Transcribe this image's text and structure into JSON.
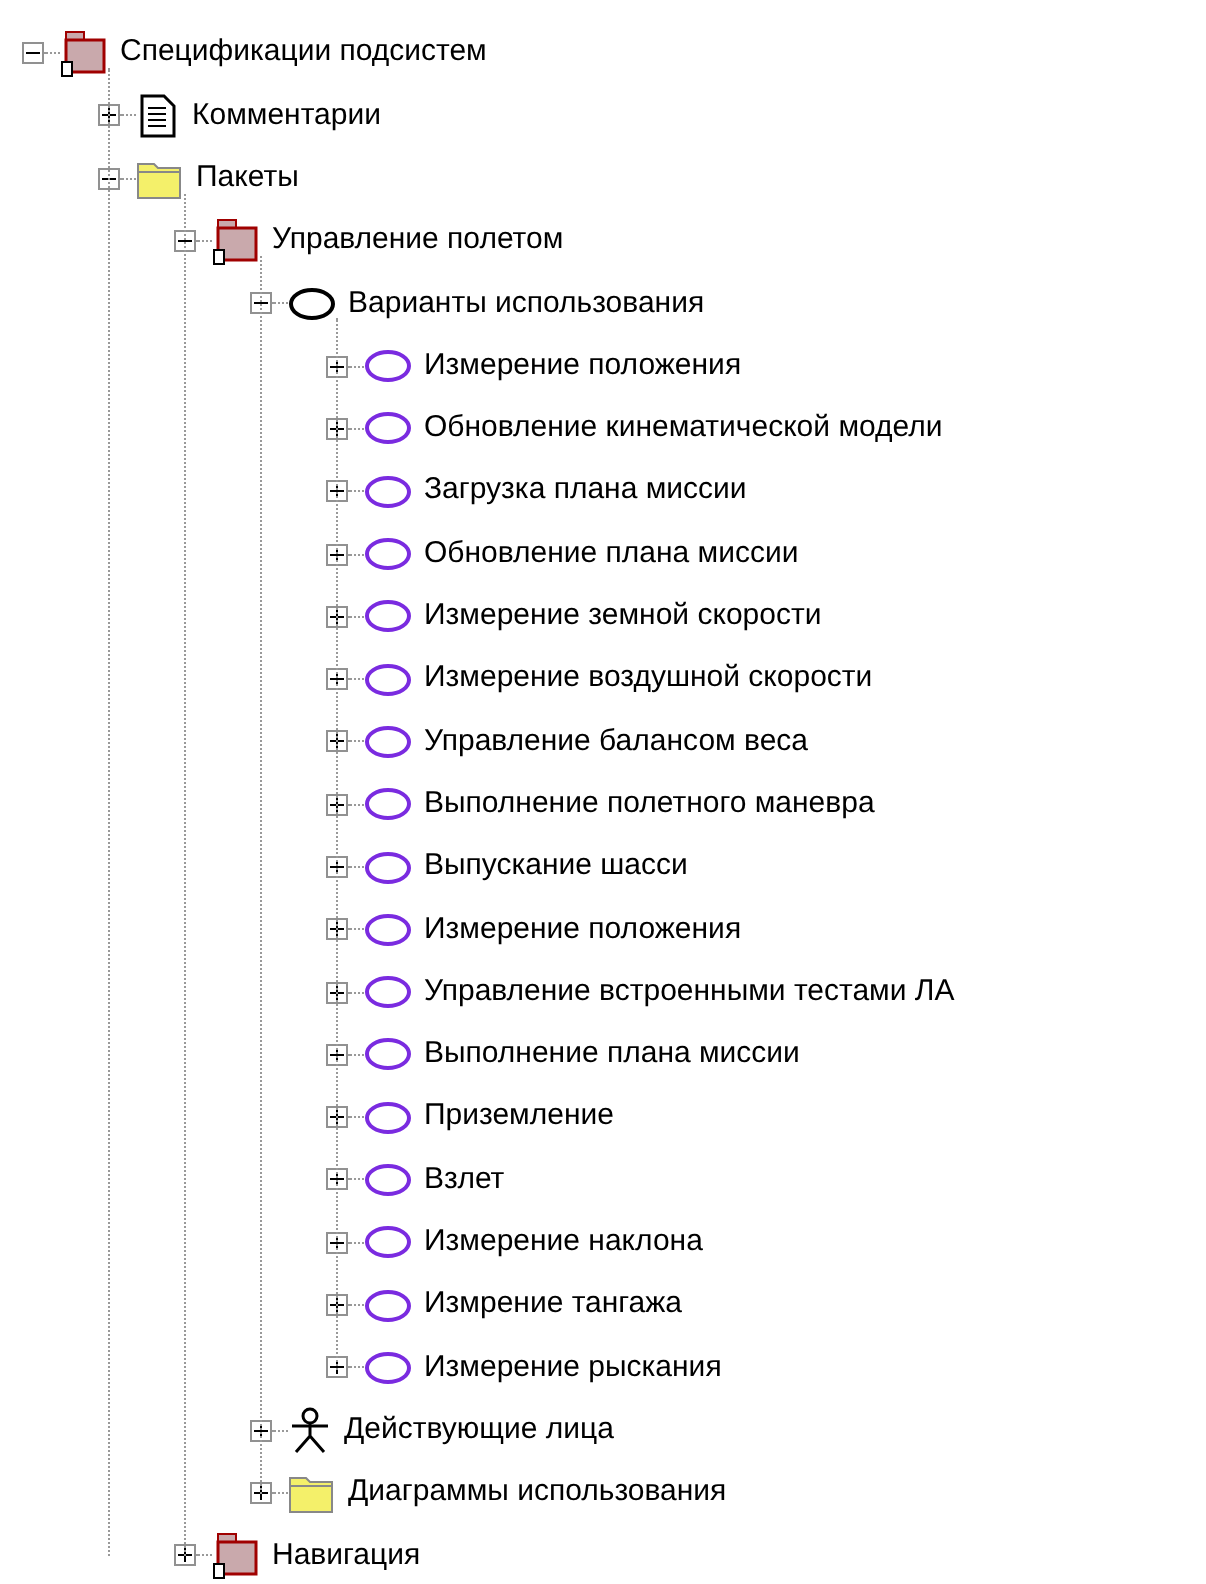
{
  "tree": [
    {
      "label": "Спецификации подсистем",
      "kind": "package",
      "expanded": true,
      "children": [
        {
          "label": "Комментарии",
          "kind": "notes",
          "expanded": false
        },
        {
          "label": "Пакеты",
          "kind": "folder",
          "expanded": true,
          "children": [
            {
              "label": "Управление полетом",
              "kind": "package",
              "expanded": true,
              "children": [
                {
                  "label": "Варианты использования",
                  "kind": "usecases",
                  "expanded": true,
                  "children": [
                    {
                      "label": "Измерение положения",
                      "kind": "usecase",
                      "expanded": false
                    },
                    {
                      "label": "Обновление кинематической модели",
                      "kind": "usecase",
                      "expanded": false
                    },
                    {
                      "label": "Загрузка плана миссии",
                      "kind": "usecase",
                      "expanded": false
                    },
                    {
                      "label": "Обновление плана миссии",
                      "kind": "usecase",
                      "expanded": false
                    },
                    {
                      "label": "Измерение земной скорости",
                      "kind": "usecase",
                      "expanded": false
                    },
                    {
                      "label": "Измерение воздушной скорости",
                      "kind": "usecase",
                      "expanded": false
                    },
                    {
                      "label": "Управление балансом веса",
                      "kind": "usecase",
                      "expanded": false
                    },
                    {
                      "label": "Выполнение полетного маневра",
                      "kind": "usecase",
                      "expanded": false
                    },
                    {
                      "label": "Выпускание шасси",
                      "kind": "usecase",
                      "expanded": false
                    },
                    {
                      "label": "Измерение положения",
                      "kind": "usecase",
                      "expanded": false
                    },
                    {
                      "label": "Управление встроенными тестами ЛА",
                      "kind": "usecase",
                      "expanded": false
                    },
                    {
                      "label": "Выполнение плана миссии",
                      "kind": "usecase",
                      "expanded": false
                    },
                    {
                      "label": "Приземление",
                      "kind": "usecase",
                      "expanded": false
                    },
                    {
                      "label": "Взлет",
                      "kind": "usecase",
                      "expanded": false
                    },
                    {
                      "label": "Измерение наклона",
                      "kind": "usecase",
                      "expanded": false
                    },
                    {
                      "label": "Измрение тангажа",
                      "kind": "usecase",
                      "expanded": false
                    },
                    {
                      "label": "Измерение рыскания",
                      "kind": "usecase",
                      "expanded": false
                    }
                  ]
                },
                {
                  "label": "Действующие лица",
                  "kind": "actors",
                  "expanded": false
                },
                {
                  "label": "Диаграммы использования",
                  "kind": "folder",
                  "expanded": false
                }
              ]
            },
            {
              "label": "Навигация",
              "kind": "package",
              "expanded": false
            }
          ]
        }
      ]
    }
  ]
}
